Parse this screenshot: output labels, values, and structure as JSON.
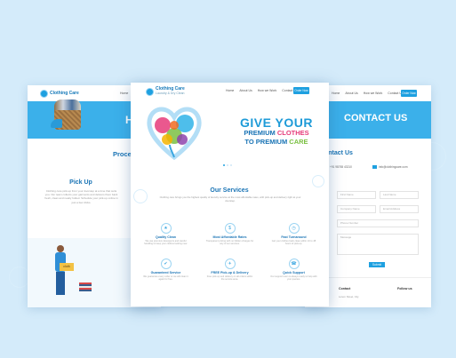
{
  "brand": {
    "name": "Clothing Care",
    "tagline": "Laundry & Dry Clean"
  },
  "colors": {
    "primary": "#1ea0e0",
    "heading": "#1a74b5",
    "background": "#d4ebfa"
  },
  "left_page": {
    "hero_title_partial": "HO",
    "process_partial": "Process",
    "section_title": "Pick Up",
    "body_text": "Clothing care pick-up from your doorstep at a time that suits you. Our team collects your garments and delivers them back fresh, clean and neatly folded. Schedule your pick-up online in just a few clicks.",
    "box_label": "cloth"
  },
  "center_page": {
    "nav": [
      "Home",
      "About Us",
      "How we Work",
      "Contact Us"
    ],
    "cta_label": "Order Now",
    "hero": {
      "line1": "GIVE YOUR",
      "line2a": "PREMIUM ",
      "line2b": "CLOTHES",
      "line3a": "TO PREMIUM ",
      "line3b": "CARE"
    },
    "services_title": "Our Services",
    "services_intro": "Clothing care brings you the highest quality of laundry service at the most affordable rates, with pick-up and delivery right at your doorstep.",
    "services": [
      {
        "name": "Quality Clean",
        "icon": "shirt-icon",
        "glyph": "★",
        "desc": "We use premium detergents and careful handling to keep your clothes looking new."
      },
      {
        "name": "Most Affordable Rates",
        "icon": "price-tag-icon",
        "glyph": "$",
        "desc": "Transparent pricing with no hidden charges for any of our services."
      },
      {
        "name": "Fast Turnaround",
        "icon": "clock-icon",
        "glyph": "◷",
        "desc": "Get your clothes back clean within 24 to 48 hours of pick-up."
      },
      {
        "name": "Guaranteed Service",
        "icon": "badge-icon",
        "glyph": "✔",
        "desc": "We guarantee every order or we will clean it again for free."
      },
      {
        "name": "FREE Pick-up & Delivery",
        "icon": "truck-icon",
        "glyph": "✈",
        "desc": "Free pick-up and delivery on all orders within the service area."
      },
      {
        "name": "Quick Support",
        "icon": "headset-icon",
        "glyph": "☎",
        "desc": "Our support team is always ready to help with your queries."
      }
    ]
  },
  "right_page": {
    "nav": [
      "Home",
      "About Us",
      "How we Work",
      "Contact Us"
    ],
    "cta_label": "Order Now",
    "hero_title": "CONTACT US",
    "section_title": "ontact Us",
    "phone": "+91 98765 43210",
    "email": "info@clothingcare.com",
    "form": {
      "first_name": "First Name",
      "last_name": "Last Name",
      "company": "Company Name",
      "email": "Email Address",
      "phone": "Phone Number",
      "message": "Message",
      "submit": "Submit"
    },
    "footer": {
      "contact_heading": "Contact",
      "follow_heading": "Follow us",
      "address": "Lorem Street, City"
    }
  }
}
